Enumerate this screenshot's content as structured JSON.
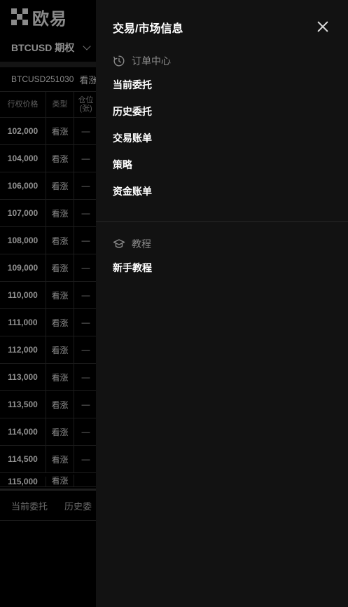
{
  "background": {
    "logo_text": "欧易",
    "instrument": "BTCUSD 期权",
    "contract": "BTCUSD251030",
    "contract_type": "看涨",
    "table_headers": {
      "strike": "行权价格",
      "type": "类型",
      "position": "仓位",
      "position_unit": "(张)"
    },
    "rows": [
      {
        "strike": "102,000",
        "type": "看涨",
        "position": "—"
      },
      {
        "strike": "104,000",
        "type": "看涨",
        "position": "—"
      },
      {
        "strike": "106,000",
        "type": "看涨",
        "position": "—"
      },
      {
        "strike": "107,000",
        "type": "看涨",
        "position": "—"
      },
      {
        "strike": "108,000",
        "type": "看涨",
        "position": "—"
      },
      {
        "strike": "109,000",
        "type": "看涨",
        "position": "—"
      },
      {
        "strike": "110,000",
        "type": "看涨",
        "position": "—"
      },
      {
        "strike": "111,000",
        "type": "看涨",
        "position": "—"
      },
      {
        "strike": "112,000",
        "type": "看涨",
        "position": "—"
      },
      {
        "strike": "113,000",
        "type": "看涨",
        "position": "—"
      },
      {
        "strike": "113,500",
        "type": "看涨",
        "position": "—"
      },
      {
        "strike": "114,000",
        "type": "看涨",
        "position": "—"
      },
      {
        "strike": "114,500",
        "type": "看涨",
        "position": "—"
      },
      {
        "strike": "115,000",
        "type": "看涨",
        "position": ""
      }
    ],
    "bottom_tabs": [
      "当前委托",
      "历史委"
    ]
  },
  "drawer": {
    "title": "交易/市场信息",
    "sections": [
      {
        "header": "订单中心",
        "icon": "clock-order-icon",
        "items": [
          "当前委托",
          "历史委托",
          "交易账单",
          "策略",
          "资金账单"
        ]
      },
      {
        "header": "教程",
        "icon": "graduation-cap-icon",
        "items": [
          "新手教程"
        ]
      }
    ]
  }
}
